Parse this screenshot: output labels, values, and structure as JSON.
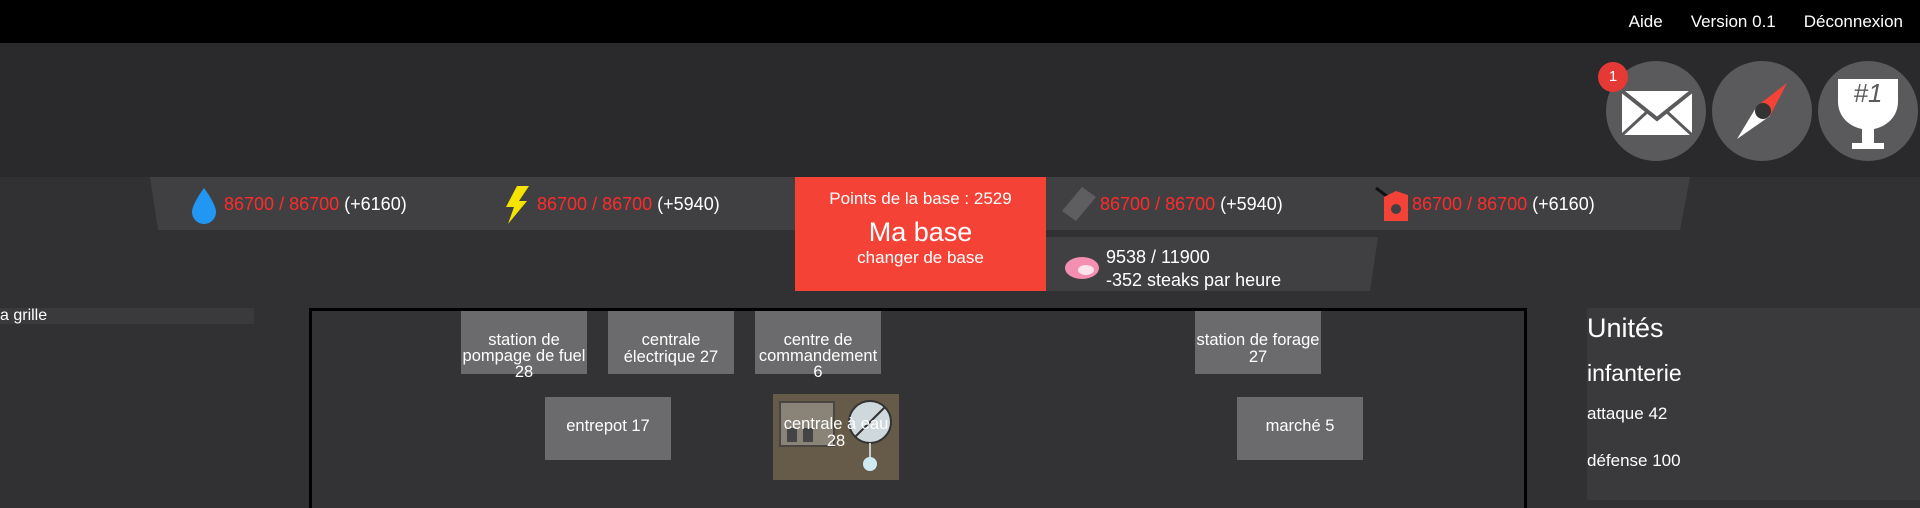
{
  "topbar": {
    "links": [
      "Aide",
      "Version 0.1",
      "Déconnexion"
    ]
  },
  "header": {
    "mail_badge": "1",
    "rank_label": "#1"
  },
  "resources": [
    {
      "name": "water",
      "icon": "water-drop-icon",
      "current": "86700",
      "max": "86700",
      "rate": "(+6160)"
    },
    {
      "name": "electricity",
      "icon": "lightning-icon",
      "current": "86700",
      "max": "86700",
      "rate": "(+5940)"
    },
    {
      "name": "metal",
      "icon": "metal-bar-icon",
      "current": "86700",
      "max": "86700",
      "rate": "(+5940)"
    },
    {
      "name": "fuel",
      "icon": "fuel-can-icon",
      "current": "86700",
      "max": "86700",
      "rate": "(+6160)"
    }
  ],
  "base": {
    "points_label": "Points de la base : 2529",
    "name": "Ma base",
    "change_label": "changer de base"
  },
  "food": {
    "icon": "steak-icon",
    "amount": "9538 / 11900",
    "rate": "-352 steaks par heure"
  },
  "left_panel": {
    "item": "a grille"
  },
  "buildings": [
    {
      "name": "station de pompage de fuel 28"
    },
    {
      "name": "centrale électrique 27"
    },
    {
      "name": "centre de commandement 6"
    },
    {
      "name": "station de forage 27"
    },
    {
      "name": "entrepot 17"
    },
    {
      "name": "centrale à eau 28"
    },
    {
      "name": "marché 5"
    }
  ],
  "units": {
    "title": "Unités",
    "type": "infanterie",
    "attack": "attaque 42",
    "defense": "défense 100"
  },
  "colors": {
    "accent_red": "#f44336",
    "resource_red": "#ff2b2b",
    "water_blue": "#2196f3",
    "lightning_yellow": "#f5e400"
  }
}
